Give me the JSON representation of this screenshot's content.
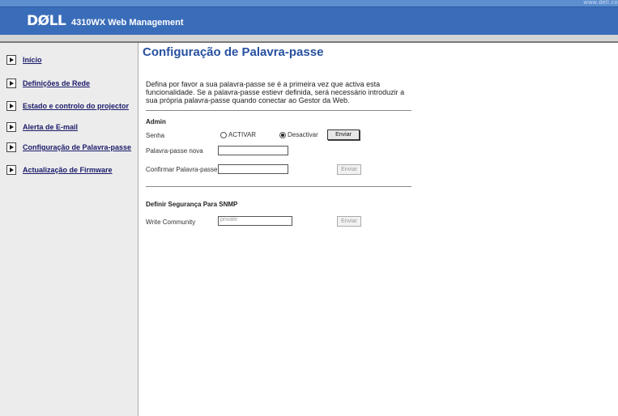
{
  "header": {
    "url": "www.dell.co",
    "logo": "DØLL",
    "product": "4310WX Web Management"
  },
  "sidebar": {
    "items": [
      {
        "label": "Início"
      },
      {
        "label": "Definições de Rede"
      },
      {
        "label": "Estado e controlo do projector"
      },
      {
        "label": "Alerta de E-mail"
      },
      {
        "label": "Configuração de Palavra-passe"
      },
      {
        "label": "Actualização de Firmware"
      }
    ]
  },
  "main": {
    "title": "Configuração de Palavra-passe",
    "intro": "Defina por favor a sua palavra-passe se é a primeira vez que activa esta funcionalidade. Se a palavra-passe estievr definida, será necessário introduzir a sua própria palavra-passe quando conectar ao Gestor da Web.",
    "admin": {
      "title": "Admin",
      "senha_label": "Senha",
      "activar": "ACTIVAR",
      "desactivar": "Desactivar",
      "selected": "Desactivar",
      "submit": "Enviar",
      "new_password_label": "Palavra-passe nova",
      "confirm_password_label": "Confirmar Palavra-passe",
      "submit2": "Enviar"
    },
    "snmp": {
      "title": "Definir Segurança Para SNMP",
      "write_community_label": "Write Community",
      "write_community_value": "private",
      "submit": "Enviar"
    }
  }
}
